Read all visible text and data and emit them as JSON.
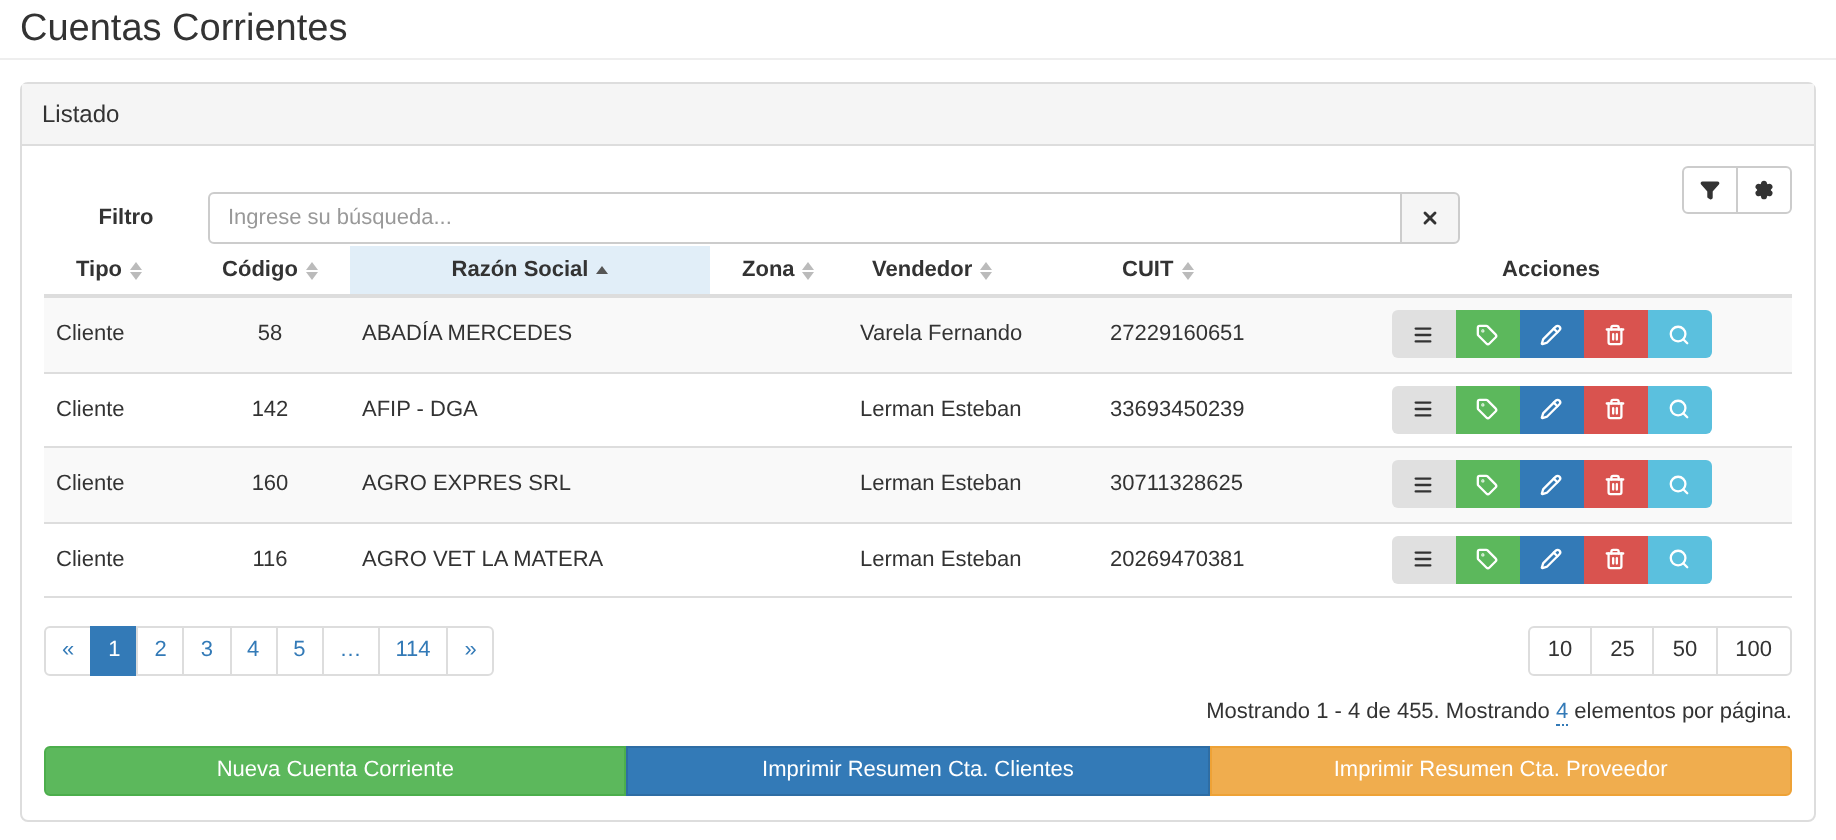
{
  "page_title": "Cuentas Corrientes",
  "panel": {
    "title": "Listado"
  },
  "filter": {
    "label": "Filtro",
    "placeholder": "Ingrese su búsqueda..."
  },
  "toolbar": [
    {
      "kind": "filter"
    },
    {
      "kind": "settings"
    }
  ],
  "table": {
    "columns": [
      {
        "label": "Tipo",
        "sortable": true,
        "selected": false
      },
      {
        "label": "Código",
        "sortable": true,
        "selected": false
      },
      {
        "label": "Razón Social",
        "sortable": true,
        "selected": true
      },
      {
        "label": "Zona",
        "sortable": true,
        "selected": false
      },
      {
        "label": "Vendedor",
        "sortable": true,
        "selected": false
      },
      {
        "label": "CUIT",
        "sortable": true,
        "selected": false
      },
      {
        "label": "Acciones",
        "sortable": false,
        "selected": false
      }
    ],
    "row_actions": [
      {
        "kind": "menu"
      },
      {
        "kind": "tag"
      },
      {
        "kind": "edit"
      },
      {
        "kind": "delete"
      },
      {
        "kind": "view"
      }
    ],
    "rows": [
      {
        "tipo": "Cliente",
        "codigo": "58",
        "razon": "ABADÍA MERCEDES",
        "zona": "",
        "vendedor": "Varela Fernando",
        "cuit": "27229160651"
      },
      {
        "tipo": "Cliente",
        "codigo": "142",
        "razon": "AFIP - DGA",
        "zona": "",
        "vendedor": "Lerman Esteban",
        "cuit": "33693450239"
      },
      {
        "tipo": "Cliente",
        "codigo": "160",
        "razon": "AGRO EXPRES SRL",
        "zona": "",
        "vendedor": "Lerman Esteban",
        "cuit": "30711328625"
      },
      {
        "tipo": "Cliente",
        "codigo": "116",
        "razon": "AGRO VET LA MATERA",
        "zona": "",
        "vendedor": "Lerman Esteban",
        "cuit": "20269470381"
      }
    ]
  },
  "pagination": [
    {
      "label": "«",
      "selected": false
    },
    {
      "label": "1",
      "selected": true
    },
    {
      "label": "2",
      "selected": false
    },
    {
      "label": "3",
      "selected": false
    },
    {
      "label": "4",
      "selected": false
    },
    {
      "label": "5",
      "selected": false
    },
    {
      "label": "…",
      "selected": false
    },
    {
      "label": "114",
      "selected": false
    },
    {
      "label": "»",
      "selected": false
    }
  ],
  "page_sizes": [
    "10",
    "25",
    "50",
    "100"
  ],
  "summary": {
    "before": "Mostrando 1 - 4 de 455. Mostrando ",
    "link": "4",
    "after": " elementos por página."
  },
  "buttons": [
    {
      "label": "Nueva Cuenta Corriente",
      "kind": "success"
    },
    {
      "label": "Imprimir Resumen Cta. Clientes",
      "kind": "primary"
    },
    {
      "label": "Imprimir Resumen Cta. Proveedor",
      "kind": "warning"
    }
  ]
}
